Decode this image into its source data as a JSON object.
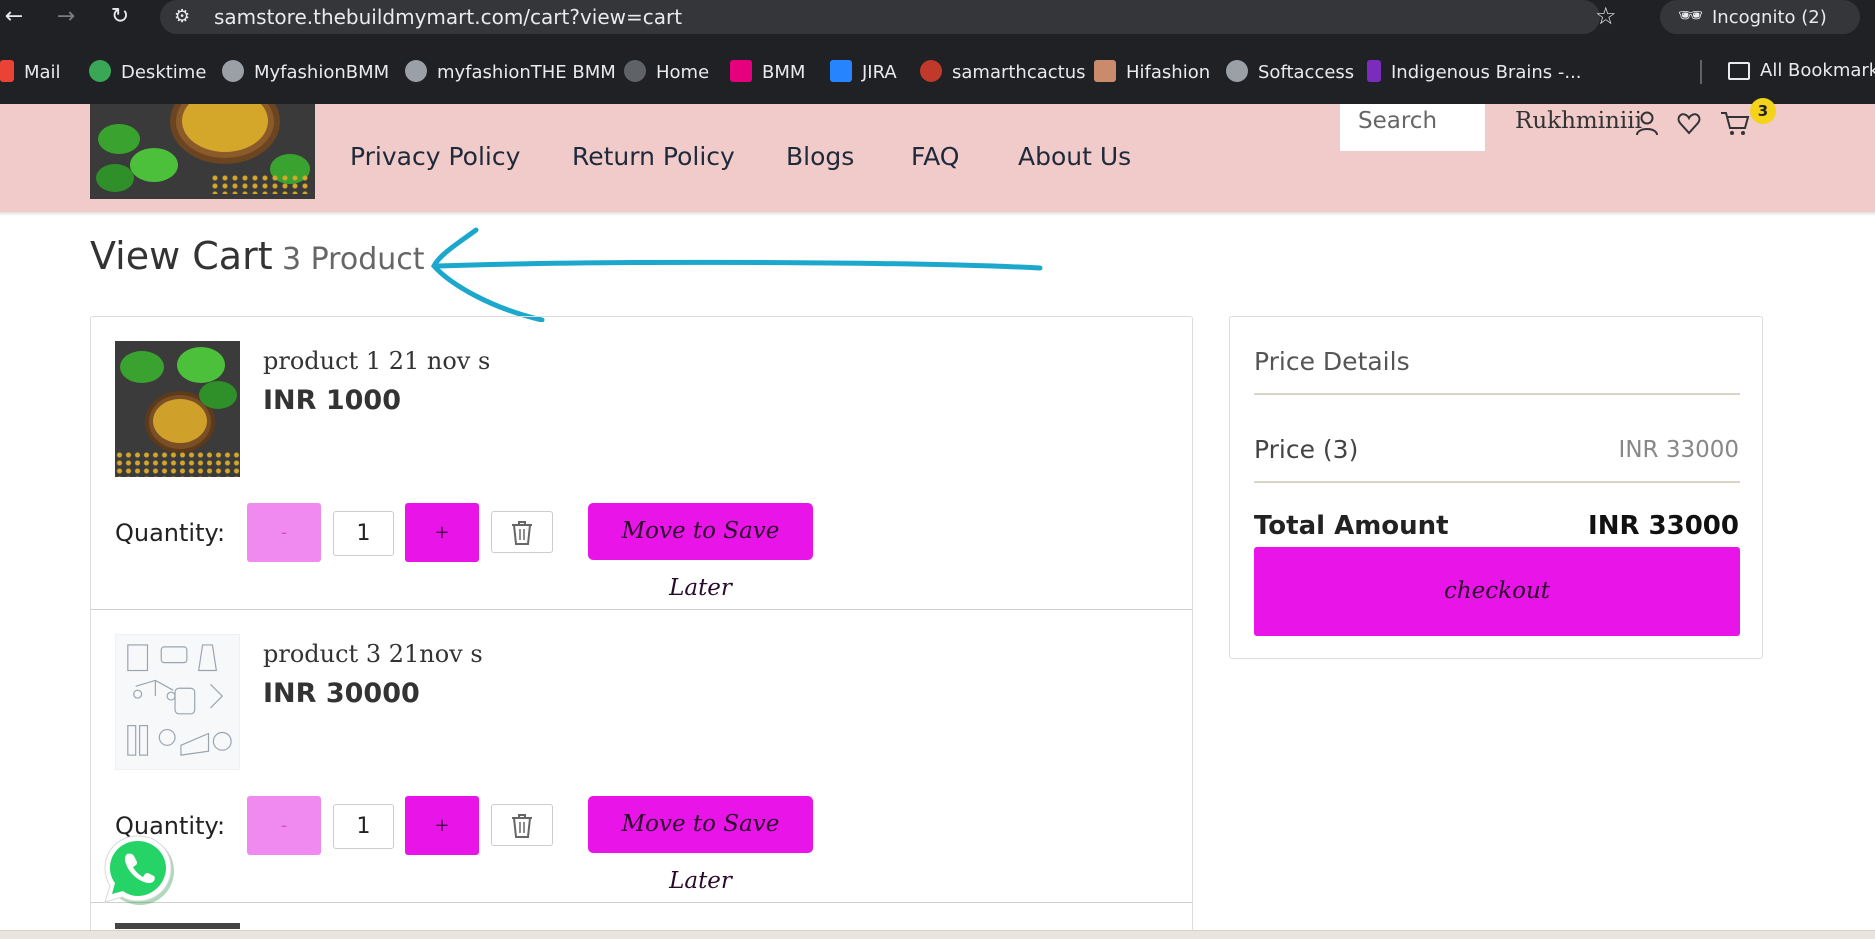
{
  "browser": {
    "url": "samstore.thebuildmymart.com/cart?view=cart",
    "incognito_label": "Incognito (2)",
    "bookmarks": [
      {
        "label": "Mail",
        "color": "#ea4335"
      },
      {
        "label": "Desktime",
        "color": "#3aa757"
      },
      {
        "label": "MyfashionBMM",
        "color": "#9aa0a6"
      },
      {
        "label": "myfashionTHE BMM",
        "color": "#9aa0a6"
      },
      {
        "label": "Home",
        "color": "#5f6368"
      },
      {
        "label": "BMM",
        "color": "#e6007e"
      },
      {
        "label": "JIRA",
        "color": "#2684ff"
      },
      {
        "label": "samarthcactus",
        "color": "#c0392b"
      },
      {
        "label": "Hifashion",
        "color": "#c98b6b"
      },
      {
        "label": "Softaccess",
        "color": "#9aa0a6"
      },
      {
        "label": "Indigenous Brains -...",
        "color": "#7b2cbf"
      }
    ],
    "all_bookmarks_label": "All Bookmarks"
  },
  "header": {
    "nav": [
      "Privacy Policy",
      "Return Policy",
      "Blogs",
      "FAQ",
      "About Us"
    ],
    "search_placeholder": "Search",
    "user_name": "Rukhminiii",
    "cart_count": "3"
  },
  "page": {
    "title": "View Cart",
    "count_label": "3 Product"
  },
  "cart": {
    "quantity_label": "Quantity:",
    "minus_label": "-",
    "plus_label": "+",
    "save_later_label": "Move to Save Later",
    "items": [
      {
        "name": "product 1 21 nov s",
        "price": "INR 1000",
        "qty": "1"
      },
      {
        "name": "product 3 21nov s",
        "price": "INR 30000",
        "qty": "1"
      }
    ]
  },
  "price_details": {
    "title": "Price Details",
    "price_label": "Price (3)",
    "price_value": "INR 33000",
    "total_label": "Total Amount",
    "total_value": "INR 33000",
    "checkout_label": "checkout"
  },
  "colors": {
    "header_bg": "#f1caca",
    "accent": "#e814e8",
    "minus_bg": "#f089f0",
    "badge": "#f5d31a",
    "annotation_arrow": "#1ba8cc"
  }
}
